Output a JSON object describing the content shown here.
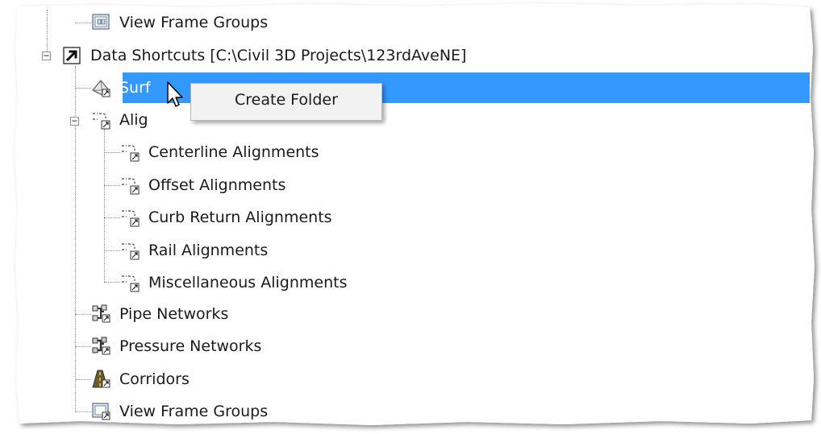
{
  "tree": {
    "items": [
      {
        "label": "View Frame Groups",
        "icon": "view-frame-groups-icon"
      },
      {
        "label": "Data Shortcuts [C:\\Civil 3D Projects\\123rdAveNE]",
        "icon": "shortcut-arrow-icon"
      },
      {
        "label": "Surf",
        "icon": "surface-icon",
        "selected": true
      },
      {
        "label": "Alig",
        "icon": "alignment-icon"
      },
      {
        "label": "Centerline Alignments",
        "icon": "alignment-icon"
      },
      {
        "label": "Offset Alignments",
        "icon": "alignment-icon"
      },
      {
        "label": "Curb Return Alignments",
        "icon": "alignment-icon"
      },
      {
        "label": "Rail Alignments",
        "icon": "alignment-icon"
      },
      {
        "label": "Miscellaneous Alignments",
        "icon": "alignment-icon"
      },
      {
        "label": "Pipe Networks",
        "icon": "pipe-network-icon"
      },
      {
        "label": "Pressure Networks",
        "icon": "pressure-network-icon"
      },
      {
        "label": "Corridors",
        "icon": "corridor-icon"
      },
      {
        "label": "View Frame Groups",
        "icon": "view-frame-groups-icon"
      }
    ]
  },
  "context_menu": {
    "items": [
      {
        "label": "Create Folder"
      }
    ]
  },
  "colors": {
    "selection": "#3399ff",
    "menu_bg": "#f2f2f2",
    "tree_lines": "#8a8a8a"
  }
}
